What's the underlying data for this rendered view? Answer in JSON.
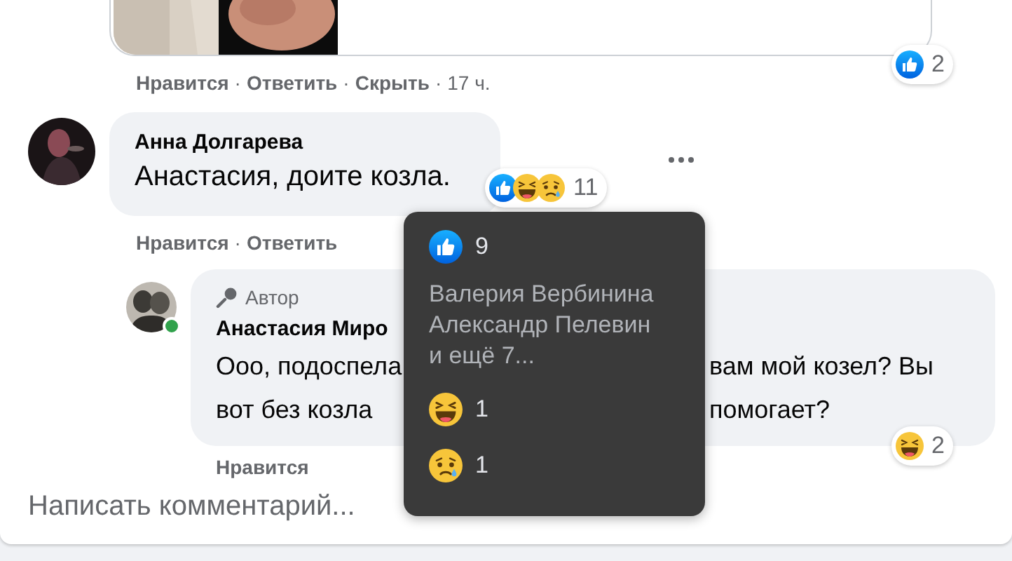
{
  "separator": "·",
  "top_comment": {
    "reactions": {
      "emojis": [
        {
          "kind": "like"
        }
      ],
      "count": "2"
    },
    "actions": [
      "Нравится",
      "Ответить",
      "Скрыть"
    ],
    "time": "17 ч."
  },
  "comments": [
    {
      "author": "Анна Долгарева",
      "text": "Анастасия, доите козла.",
      "reactions": {
        "emojis": [
          {
            "kind": "like"
          },
          {
            "kind": "haha"
          },
          {
            "kind": "sad"
          }
        ],
        "count": "11"
      },
      "actions": [
        "Нравится",
        "Ответить"
      ],
      "replies": [
        {
          "badge": "Автор",
          "author": "Анастасия Миро",
          "online": true,
          "text_lines": [
            [
              "Ооо, подоспела",
              "вам мой козел? Вы"
            ],
            [
              "вот без козла",
              "помогает?"
            ]
          ],
          "reactions": {
            "emojis": [
              {
                "kind": "haha"
              }
            ],
            "count": "2"
          },
          "actions": [
            "Нравится"
          ]
        }
      ]
    }
  ],
  "composer": {
    "placeholder": "Написать комментарий..."
  },
  "tooltip": {
    "groups": [
      {
        "kind": "like",
        "count": "9",
        "names": [
          "Валерия Вербинина",
          "Александр Пелевин",
          "и ещё 7..."
        ]
      },
      {
        "kind": "haha",
        "count": "1"
      },
      {
        "kind": "sad",
        "count": "1"
      }
    ]
  }
}
